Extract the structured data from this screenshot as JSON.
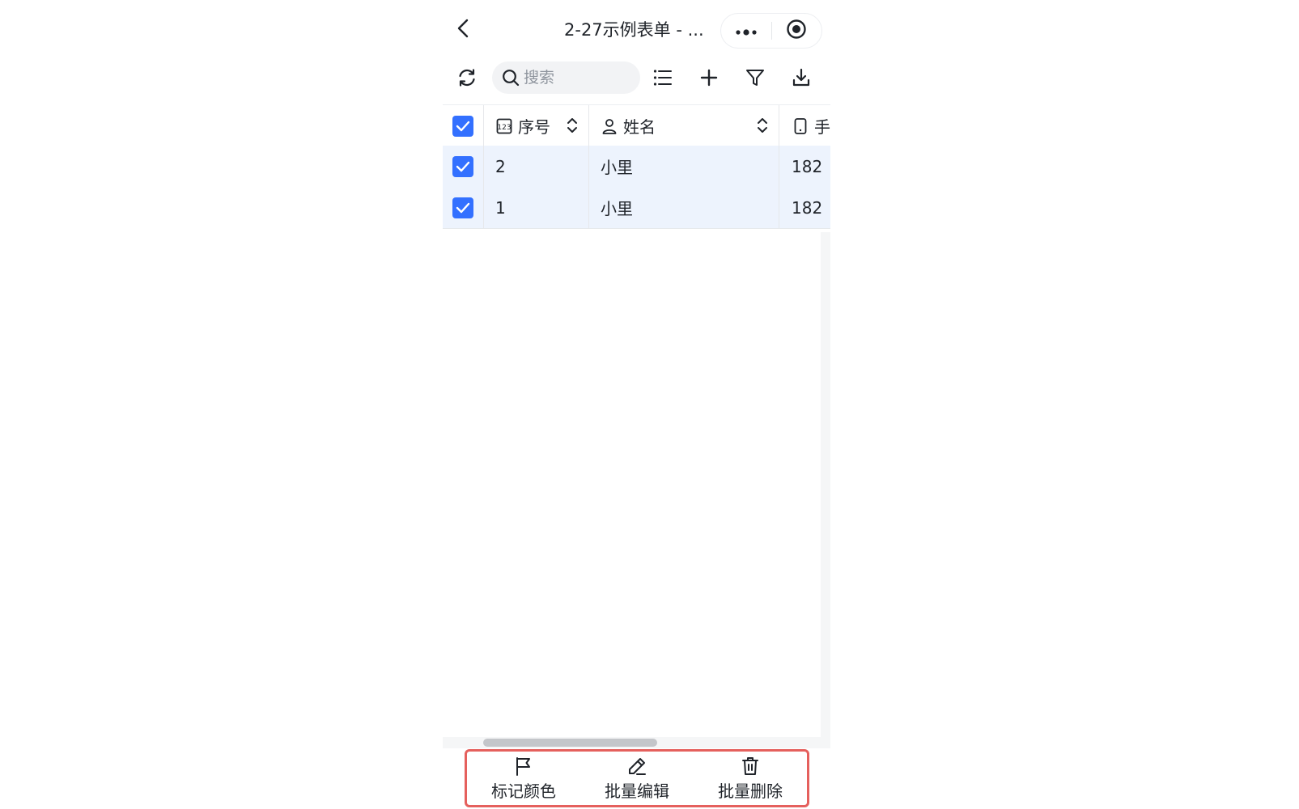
{
  "nav": {
    "title": "2-27示例表单 - ...",
    "back_icon": "chevron-left-icon",
    "more_icon": "more-dots-icon",
    "close_icon": "record-circle-icon"
  },
  "toolbar": {
    "search_placeholder": "搜索",
    "search_value": "",
    "icons": [
      "refresh-icon",
      "list-icon",
      "plus-icon",
      "filter-icon",
      "download-icon"
    ]
  },
  "table": {
    "columns": [
      {
        "label": "序号",
        "icon": "number-field-icon"
      },
      {
        "label": "姓名",
        "icon": "person-icon"
      },
      {
        "label": "手",
        "icon": "phone-icon"
      }
    ],
    "rows": [
      {
        "checked": true,
        "seq": "2",
        "name": "小里",
        "phone": "182"
      },
      {
        "checked": true,
        "seq": "1",
        "name": "小里",
        "phone": "182"
      }
    ],
    "header_checked": true
  },
  "actions": [
    {
      "label": "标记颜色",
      "icon": "flag-icon"
    },
    {
      "label": "批量编辑",
      "icon": "pencil-icon"
    },
    {
      "label": "批量删除",
      "icon": "trash-icon"
    }
  ],
  "colors": {
    "accent": "#3370ff",
    "selected_row": "#edf3fd",
    "highlight_border": "#e5605d"
  }
}
